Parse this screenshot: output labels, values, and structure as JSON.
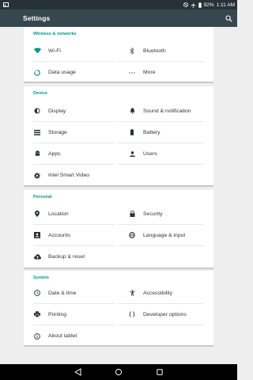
{
  "status_bar": {
    "battery": "92%",
    "time": "1:11 AM"
  },
  "app_bar": {
    "title": "Settings"
  },
  "sections": {
    "wireless": {
      "title": "Wireless & networks",
      "wifi": "Wi‑Fi",
      "bluetooth": "Bluetooth",
      "data_usage": "Data usage",
      "more": "More"
    },
    "device": {
      "title": "Device",
      "display": "Display",
      "sound": "Sound & notification",
      "storage": "Storage",
      "battery": "Battery",
      "apps": "Apps",
      "users": "Users",
      "intel": "Intel Smart Video"
    },
    "personal": {
      "title": "Personal",
      "location": "Location",
      "security": "Security",
      "accounts": "Accounts",
      "language": "Language & input",
      "backup": "Backup & reset"
    },
    "system": {
      "title": "System",
      "datetime": "Date & time",
      "accessibility": "Accessibility",
      "printing": "Printing",
      "developer": "Developer options",
      "about": "About tablet"
    }
  },
  "icons": {
    "accent": "#009688",
    "icon_color": "#546e7a"
  }
}
